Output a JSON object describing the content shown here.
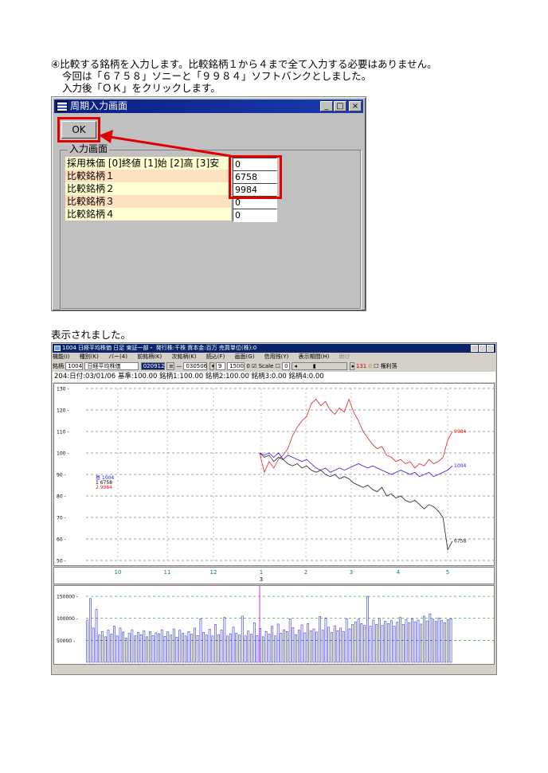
{
  "instructions": {
    "line1": "④比較する銘柄を入力します。比較銘柄１から４まで全て入力する必要はありません。",
    "line2": "今回は「６７５８」ソニーと「９９８４」ソフトバンクとしました。",
    "line3": "入力後「ＯＫ」をクリックします。"
  },
  "dialog": {
    "title": "周期入力画面",
    "ok_label": "OK",
    "group_title": "入力画面",
    "fields": [
      {
        "label": "採用株価 [0]終値 [1]始 [2]高 [3]安",
        "value": "0"
      },
      {
        "label": "比較銘柄１",
        "value": "6758"
      },
      {
        "label": "比較銘柄２",
        "value": "9984"
      },
      {
        "label": "比較銘柄３",
        "value": "0"
      },
      {
        "label": "比較銘柄４",
        "value": "0"
      }
    ],
    "min_glyph": "_",
    "max_glyph": "□",
    "close_glyph": "×"
  },
  "caption": "表示されました。",
  "chart_window": {
    "title": "1004 日経平均株価 日足 東証一部・ 発行株:千株 資本金:百万 売買単位(株):0",
    "menu": [
      "機能(I)",
      "種別(K)",
      "バー(4)",
      "前銘柄(K)",
      "次銘柄(K)",
      "読込(F)",
      "画面(G)",
      "信用残(Y)",
      "表示期間(H)",
      "助け"
    ],
    "toolbar": {
      "label": "銘柄",
      "code": "1004",
      "name": "日経平均株価",
      "date_from": "020912",
      "date_to": "030506",
      "field_a": "9",
      "field_b": "1500",
      "field_c": "0",
      "scale_label": "Scale",
      "scale_value": "0",
      "counter": "131",
      "counter2": "0",
      "checkbox_label": "権利落"
    },
    "info_line": "204:日付:03/01/06  基準:100.00  銘柄1:100.00  銘柄2:100.00  銘柄3:0.00  銘柄4:0.00"
  },
  "chart_data": [
    {
      "type": "line",
      "y_ticks": [
        50,
        60,
        70,
        80,
        90,
        100,
        110,
        120,
        130
      ],
      "ylim": [
        50,
        130
      ],
      "x_labels": [
        "10",
        "11",
        "12",
        "1",
        "2",
        "3",
        "4",
        "5"
      ],
      "x_sub_label": "3",
      "grid": true,
      "legend": [
        {
          "prefix": "基",
          "name": "1004",
          "color": "#2020e0"
        },
        {
          "prefix": "1",
          "name": "6758",
          "color": "#000000"
        },
        {
          "prefix": "2",
          "name": "9984",
          "color": "#e02020"
        }
      ],
      "series": [
        {
          "name": "9984",
          "color": "#e02020",
          "end_label": "9984",
          "values": [
            100,
            91,
            96,
            93,
            97,
            99,
            102,
            108,
            112,
            115,
            117,
            123,
            125,
            122,
            124,
            120,
            118,
            121,
            119,
            125,
            119,
            115,
            110,
            107,
            104,
            102,
            103,
            99,
            98,
            96,
            97,
            95,
            96,
            93,
            95,
            94,
            97,
            95,
            96,
            98,
            106,
            110
          ]
        },
        {
          "name": "1004",
          "color": "#2020e0",
          "end_label": "1004",
          "values": [
            100,
            99,
            100,
            98,
            100,
            97,
            99,
            98,
            97,
            96,
            97,
            95,
            93,
            92,
            93,
            91,
            92,
            93,
            92,
            93,
            94,
            95,
            94,
            93,
            94,
            93,
            92,
            91,
            90,
            91,
            92,
            91,
            90,
            91,
            89,
            90,
            91,
            89,
            90,
            91,
            92,
            94
          ]
        },
        {
          "name": "6758",
          "color": "#202020",
          "end_label": "6758",
          "values": [
            100,
            98,
            99,
            96,
            98,
            97,
            95,
            94,
            95,
            93,
            94,
            92,
            91,
            92,
            90,
            89,
            90,
            88,
            89,
            88,
            86,
            85,
            84,
            85,
            83,
            82,
            84,
            80,
            81,
            79,
            80,
            78,
            77,
            78,
            76,
            74,
            76,
            75,
            73,
            70,
            55,
            59
          ]
        }
      ]
    },
    {
      "type": "bar",
      "y_ticks": [
        50000,
        100000,
        150000
      ],
      "ylim": [
        0,
        170000
      ],
      "values": [
        96000,
        145000,
        78000,
        120000,
        62000,
        70000,
        58000,
        73000,
        64000,
        82000,
        60000,
        78000,
        69000,
        55000,
        66000,
        74000,
        60000,
        68000,
        63000,
        72000,
        58000,
        70000,
        61000,
        67000,
        65000,
        74000,
        59000,
        69000,
        62000,
        76000,
        57000,
        73000,
        66000,
        60000,
        70000,
        64000,
        78000,
        61000,
        99000,
        68000,
        62000,
        75000,
        60000,
        86000,
        63000,
        73000,
        102000,
        60000,
        65000,
        80000,
        66000,
        62000,
        105000,
        60000,
        71000,
        64000,
        90000,
        61000,
        77000,
        58000,
        70000,
        64000,
        82000,
        60000,
        87000,
        66000,
        74000,
        70000,
        99000,
        79000,
        63000,
        73000,
        85000,
        67000,
        88000,
        72000,
        76000,
        69000,
        104000,
        73000,
        101000,
        80000,
        68000,
        83000,
        72000,
        78000,
        70000,
        99000,
        76000,
        86000,
        92000,
        98000,
        88000,
        84000,
        150000,
        82000,
        96000,
        86000,
        100000,
        84000,
        93000,
        88000,
        95000,
        82000,
        91000,
        102000,
        86000,
        97000,
        90000,
        99000,
        92000,
        96000,
        87000,
        105000,
        94000,
        110000,
        98000,
        93000,
        101000,
        95000,
        90000,
        97000,
        99000
      ]
    }
  ]
}
